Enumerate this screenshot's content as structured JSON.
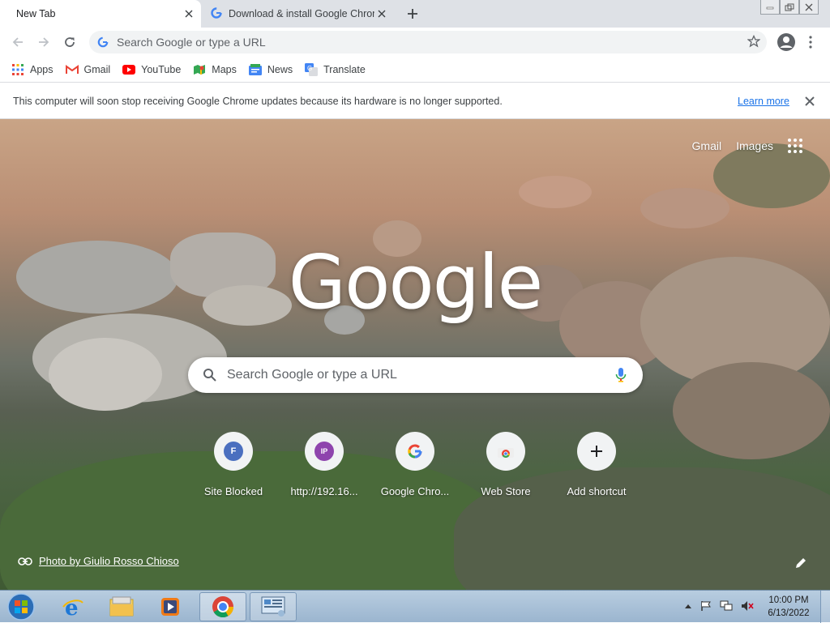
{
  "tabs": [
    {
      "title": "New Tab"
    },
    {
      "title": "Download & install Google Chrome"
    }
  ],
  "omnibox": {
    "placeholder": "Search Google or type a URL"
  },
  "bookmarks": [
    {
      "label": "Apps",
      "icon": "apps-grid-icon"
    },
    {
      "label": "Gmail",
      "icon": "gmail-icon"
    },
    {
      "label": "YouTube",
      "icon": "youtube-icon"
    },
    {
      "label": "Maps",
      "icon": "maps-icon"
    },
    {
      "label": "News",
      "icon": "news-icon"
    },
    {
      "label": "Translate",
      "icon": "translate-icon"
    }
  ],
  "infobar": {
    "message": "This computer will soon stop receiving Google Chrome updates because its hardware is no longer supported.",
    "link": "Learn more"
  },
  "ntp": {
    "top_links": [
      "Gmail",
      "Images"
    ],
    "logo": "Google",
    "search_placeholder": "Search Google or type a URL",
    "shortcuts": [
      {
        "label": "Site Blocked",
        "initial": "F",
        "color": "#4a6fbf"
      },
      {
        "label": "http://192.16...",
        "initial": "IP",
        "color": "#8e44ad"
      },
      {
        "label": "Google Chro...",
        "initial": "G",
        "color": "#ffffff"
      },
      {
        "label": "Web Store",
        "initial": "",
        "color": "#ffffff"
      },
      {
        "label": "Add shortcut",
        "initial": "+",
        "color": "#ffffff"
      }
    ],
    "photo_credit": "Photo by Giulio Rosso Chioso"
  },
  "taskbar": {
    "time": "10:00 PM",
    "date": "6/13/2022"
  }
}
